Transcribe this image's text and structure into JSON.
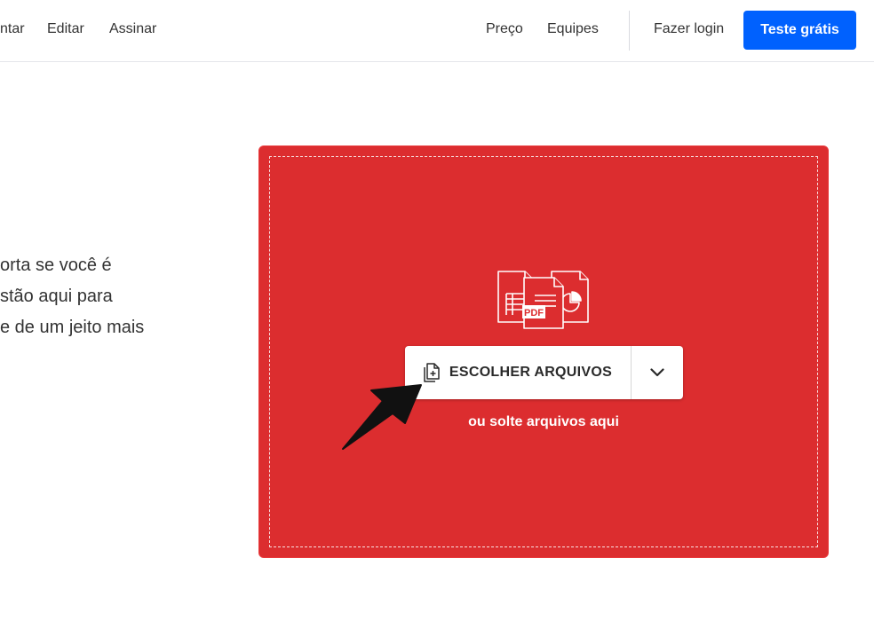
{
  "header": {
    "nav_left": [
      "ntar",
      "Editar",
      "Assinar"
    ],
    "nav_right": [
      "Preço",
      "Equipes"
    ],
    "login": "Fazer login",
    "cta": "Teste grátis",
    "cta_color": "#0061fe"
  },
  "intro": {
    "lines": [
      "orta se você é",
      "stão aqui para",
      "e de um jeito mais"
    ]
  },
  "dropzone": {
    "background": "#dc2d2f",
    "icon": "files-icon",
    "choose_button": "ESCOLHER ARQUIVOS",
    "choose_icon": "file-add-icon",
    "dropdown_icon": "chevron-down-icon",
    "pdf_badge": "PDF",
    "hint": "ou solte arquivos aqui"
  },
  "annotation": {
    "icon": "arrow-pointer-icon"
  }
}
